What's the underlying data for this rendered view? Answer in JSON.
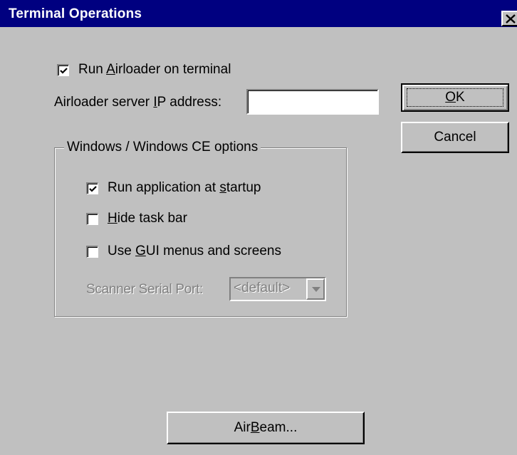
{
  "window": {
    "title": "Terminal Operations"
  },
  "options": {
    "run_airloader": {
      "label_pre": "Run ",
      "label_key": "A",
      "label_post": "irloader on terminal",
      "checked": true
    },
    "server_ip": {
      "label_pre": "Airloader server ",
      "label_key": "I",
      "label_post": "P address:",
      "value": ""
    }
  },
  "group": {
    "title": "Windows / Windows CE options",
    "run_app": {
      "label_pre": "Run application at ",
      "label_key": "s",
      "label_post": "tartup",
      "checked": true
    },
    "hide_taskbar": {
      "label_pre": "",
      "label_key": "H",
      "label_post": "ide task bar",
      "checked": false
    },
    "gui_menus": {
      "label_pre": "Use ",
      "label_key": "G",
      "label_post": "UI menus and screens",
      "checked": false
    },
    "scanner_port": {
      "label": "Scanner Serial Port:",
      "value": "<default>"
    }
  },
  "buttons": {
    "ok": {
      "label_pre": "",
      "label_key": "O",
      "label_post": "K"
    },
    "cancel": {
      "label": "Cancel"
    },
    "airbeam": {
      "label_pre": "Air",
      "label_key": "B",
      "label_post": "eam..."
    }
  },
  "icons": {
    "close": "close-icon",
    "check": "checkmark-icon",
    "dropdown": "dropdown-arrow-icon"
  }
}
